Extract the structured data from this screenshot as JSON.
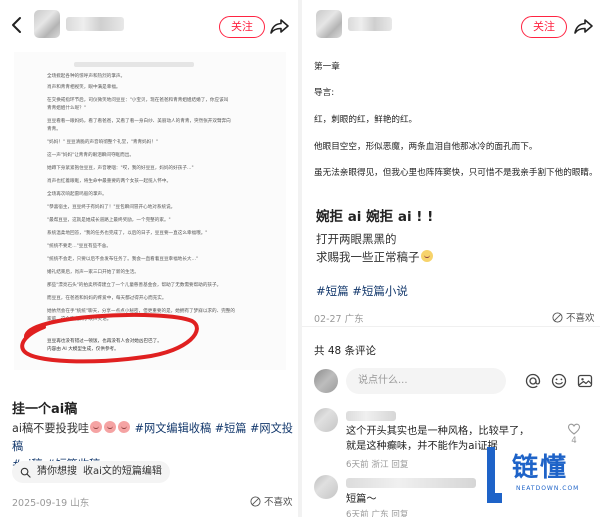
{
  "left": {
    "header": {
      "follow_label": "关注"
    },
    "document_lines": [
      "全场掀起各种的惊呼声和热烈的掌声。",
      "肖声和青青相视笑，眼中满是幸福。",
      "在交换戒指环节后，司仪微笑地问豆豆：\"小宝贝，现在爸爸和青青姐姐结婚了，你应该叫",
      "青青姐姐什么呢？\"",
      "豆豆看看一眼妈妈，看了看爸爸，又看了看一身白纱、美丽动人的青青，突然张开双臂奔向",
      "青青。",
      "\"妈妈！\" 豆豆清脆的声音响彻整个礼堂，\"青青妈妈！\"",
      "这一声\"妈妈\"让青青的眼泪瞬间夺眶而出。",
      "她蹲下身紧紧抱住豆豆，声音哽咽：\"哎，我的好豆豆，妈妈的好孩子…\"",
      "肖声也红着眼眶，将生命中最重要的两个女孩一起揽入怀中。",
      "全场再次响起雷鸣般的掌声。",
      "\"恭喜宿主，豆豆终于有妈妈了！\"豆包瞬间冒开心地对系统说。",
      "\"最帮豆豆，这就是她成长道路上最终奖励，一个完整的家。\"",
      "系统温柔地回答，\"我的任务也完成了，以后的日子，豆豆要一直这么幸福哦。\"",
      "\"统统不要走…\"豆豆有些不舍。",
      "\"统统不会走，只要以后不会发布任务了。我会一直看着豆豆幸福地长大…\"",
      "婚礼结束后，肖声一家三口开始了新的生活。",
      "那些\"漂亮石头\"的拍卖所得建立了一个儿童慈善基金会，帮助了无数需要帮助的孩子。",
      "而豆豆，在爸爸和妈妈的疼爱中，每天都过得开心而充实。",
      "她依然会在手\"统统\"聊天，分享一点点小秘密，但更重要的是，她拥有了梦寐以求的、完整的",
      "家庭。这个家充满了欢声笑语。",
      "豆豆再也没有错过一顿饭，也再没有人会对她凶巴巴了。",
      "内容由 AI 大模型生成，仅供参考。"
    ],
    "post_title": "挂一个ai稿",
    "post_body_prefix": "ai稿不要投我哇",
    "post_tags_inline": [
      "#网文编辑收稿",
      "#短篇",
      "#网文投稿"
    ],
    "post_tags_line2": [
      "#ai稿",
      "#短篇收稿"
    ],
    "search_chip": {
      "label1": "猜你想搜",
      "label2": "收ai文的短篇编辑"
    },
    "meta": "2025-09-19 山东",
    "dislike_label": "不喜欢"
  },
  "right": {
    "header": {
      "follow_label": "关注"
    },
    "doc_lines": [
      "第一章",
      "导言:",
      "红，刺眼的红，鲜艳的红。",
      "他眼目空空，形似恶魔，两条血泪自他那冰冷的面孔而下。",
      "虽无法亲眼得见，但我心里也阵阵窦快，只可惜不是我亲手割下他的眼睛。"
    ],
    "post_title": "婉拒 ai 婉拒 ai ! !",
    "post_line1": "打开两眼黑黑的",
    "post_line2": "求赐我一些正常稿子",
    "tags": [
      "#短篇",
      "#短篇小说"
    ],
    "meta": "02-27 广东",
    "dislike_label": "不喜欢",
    "comments_count": "共 48 条评论",
    "comment_placeholder": "说点什么...",
    "comments": [
      {
        "text": "这个开头其实也是一种风格，比较早了，就是这种癫味，并不能作为ai证据",
        "meta": "6天前 浙江  回复",
        "likes": "4"
      },
      {
        "text": "短篇～",
        "meta": "6天前 广东  回复",
        "likes": ""
      }
    ]
  },
  "watermark": {
    "brand": "链懂",
    "sub": "NEATDOWN.COM"
  },
  "colors": {
    "accent_red": "#ff2442",
    "tag_blue": "#13386c",
    "watermark_blue": "#1e63c8"
  }
}
